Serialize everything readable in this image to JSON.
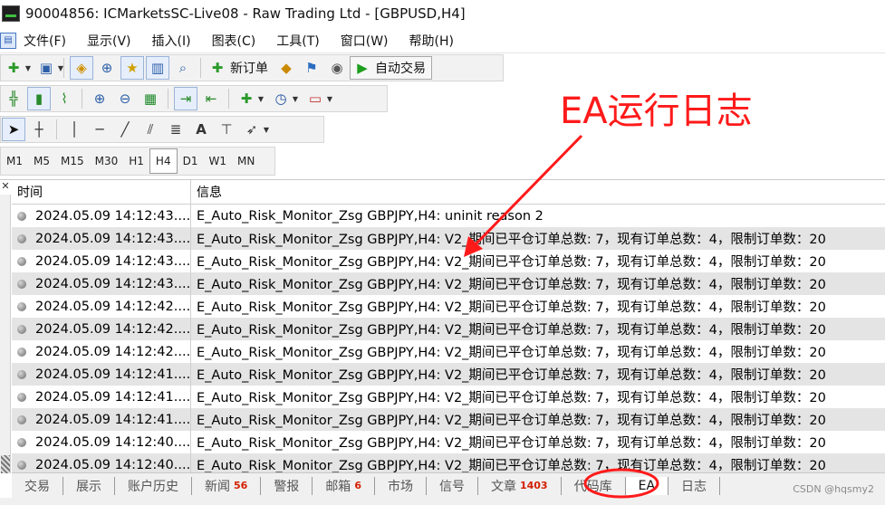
{
  "window": {
    "title": "90004856: ICMarketsSC-Live08 - Raw Trading Ltd - [GBPUSD,H4]"
  },
  "menu": {
    "items": [
      "文件(F)",
      "显示(V)",
      "插入(I)",
      "图表(C)",
      "工具(T)",
      "窗口(W)",
      "帮助(H)"
    ]
  },
  "toolbar": {
    "new_order": "新订单",
    "auto_trading": "自动交易"
  },
  "timeframes": [
    "M1",
    "M5",
    "M15",
    "M30",
    "H1",
    "H4",
    "D1",
    "W1",
    "MN"
  ],
  "timeframe_active": "H4",
  "log": {
    "col_time": "时间",
    "col_info": "信息",
    "rows": [
      {
        "time": "2024.05.09 14:12:43....",
        "info": "E_Auto_Risk_Monitor_Zsg GBPJPY,H4: uninit reason 2"
      },
      {
        "time": "2024.05.09 14:12:43....",
        "info": "E_Auto_Risk_Monitor_Zsg GBPJPY,H4: V2_期间已平仓订单总数: 7，现有订单总数：4，限制订单数：20"
      },
      {
        "time": "2024.05.09 14:12:43....",
        "info": "E_Auto_Risk_Monitor_Zsg GBPJPY,H4: V2_期间已平仓订单总数: 7，现有订单总数：4，限制订单数：20"
      },
      {
        "time": "2024.05.09 14:12:43....",
        "info": "E_Auto_Risk_Monitor_Zsg GBPJPY,H4: V2_期间已平仓订单总数: 7，现有订单总数：4，限制订单数：20"
      },
      {
        "time": "2024.05.09 14:12:42....",
        "info": "E_Auto_Risk_Monitor_Zsg GBPJPY,H4: V2_期间已平仓订单总数: 7，现有订单总数：4，限制订单数：20"
      },
      {
        "time": "2024.05.09 14:12:42....",
        "info": "E_Auto_Risk_Monitor_Zsg GBPJPY,H4: V2_期间已平仓订单总数: 7，现有订单总数：4，限制订单数：20"
      },
      {
        "time": "2024.05.09 14:12:42....",
        "info": "E_Auto_Risk_Monitor_Zsg GBPJPY,H4: V2_期间已平仓订单总数: 7，现有订单总数：4，限制订单数：20"
      },
      {
        "time": "2024.05.09 14:12:41....",
        "info": "E_Auto_Risk_Monitor_Zsg GBPJPY,H4: V2_期间已平仓订单总数: 7，现有订单总数：4，限制订单数：20"
      },
      {
        "time": "2024.05.09 14:12:41....",
        "info": "E_Auto_Risk_Monitor_Zsg GBPJPY,H4: V2_期间已平仓订单总数: 7，现有订单总数：4，限制订单数：20"
      },
      {
        "time": "2024.05.09 14:12:41....",
        "info": "E_Auto_Risk_Monitor_Zsg GBPJPY,H4: V2_期间已平仓订单总数: 7，现有订单总数：4，限制订单数：20"
      },
      {
        "time": "2024.05.09 14:12:40....",
        "info": "E_Auto_Risk_Monitor_Zsg GBPJPY,H4: V2_期间已平仓订单总数: 7，现有订单总数：4，限制订单数：20"
      },
      {
        "time": "2024.05.09 14:12:40....",
        "info": "E_Auto_Risk_Monitor_Zsg GBPJPY,H4: V2_期间已平仓订单总数: 7，现有订单总数：4，限制订单数：20"
      }
    ]
  },
  "tabs": [
    {
      "label": "交易",
      "badge": ""
    },
    {
      "label": "展示",
      "badge": ""
    },
    {
      "label": "账户历史",
      "badge": ""
    },
    {
      "label": "新闻",
      "badge": "56"
    },
    {
      "label": "警报",
      "badge": ""
    },
    {
      "label": "邮箱",
      "badge": "6"
    },
    {
      "label": "市场",
      "badge": ""
    },
    {
      "label": "信号",
      "badge": ""
    },
    {
      "label": "文章",
      "badge": "1403"
    },
    {
      "label": "代码库",
      "badge": ""
    },
    {
      "label": "EA",
      "badge": ""
    },
    {
      "label": "日志",
      "badge": ""
    }
  ],
  "tab_active": "EA",
  "annotation": {
    "text": "EA运行日志",
    "color": "#ff1a1a"
  },
  "watermark": "CSDN @hqsmy2"
}
